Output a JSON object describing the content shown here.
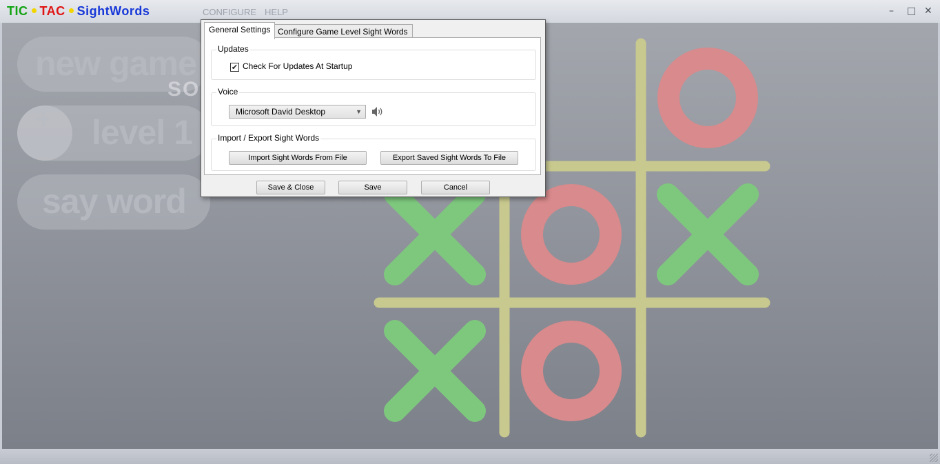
{
  "app": {
    "logo": {
      "tic": "TIC",
      "tac": "TAC",
      "sight": "SightWords"
    },
    "menu": [
      {
        "label": "CONFIGURE"
      },
      {
        "label": "HELP"
      }
    ],
    "window_buttons": {
      "minimize": "–",
      "maximize": "□",
      "close": "✕"
    }
  },
  "sidebar": {
    "new_game": "new game",
    "plus": "+",
    "minus": "–",
    "level": "level 1",
    "say_word": "say word"
  },
  "watermark": "SOFTPEDIA",
  "board": {
    "cells": [
      [
        "",
        "",
        "O"
      ],
      [
        "X",
        "O",
        "X"
      ],
      [
        "X",
        "O",
        ""
      ]
    ],
    "colors": {
      "x": "#7ec87e",
      "o": "#d88a8c",
      "grid": "#c8c98e"
    }
  },
  "dialog": {
    "tabs": [
      {
        "label": "General Settings"
      },
      {
        "label": "Configure Game Level Sight Words"
      }
    ],
    "updates": {
      "title": "Updates",
      "check_label": "Check For Updates At Startup",
      "checked": true
    },
    "voice": {
      "title": "Voice",
      "selected": "Microsoft David Desktop"
    },
    "import_export": {
      "title": "Import / Export Sight Words",
      "import_label": "Import Sight Words From File",
      "export_label": "Export Saved Sight Words To File"
    },
    "buttons": {
      "save_close": "Save & Close",
      "save": "Save",
      "cancel": "Cancel"
    }
  }
}
